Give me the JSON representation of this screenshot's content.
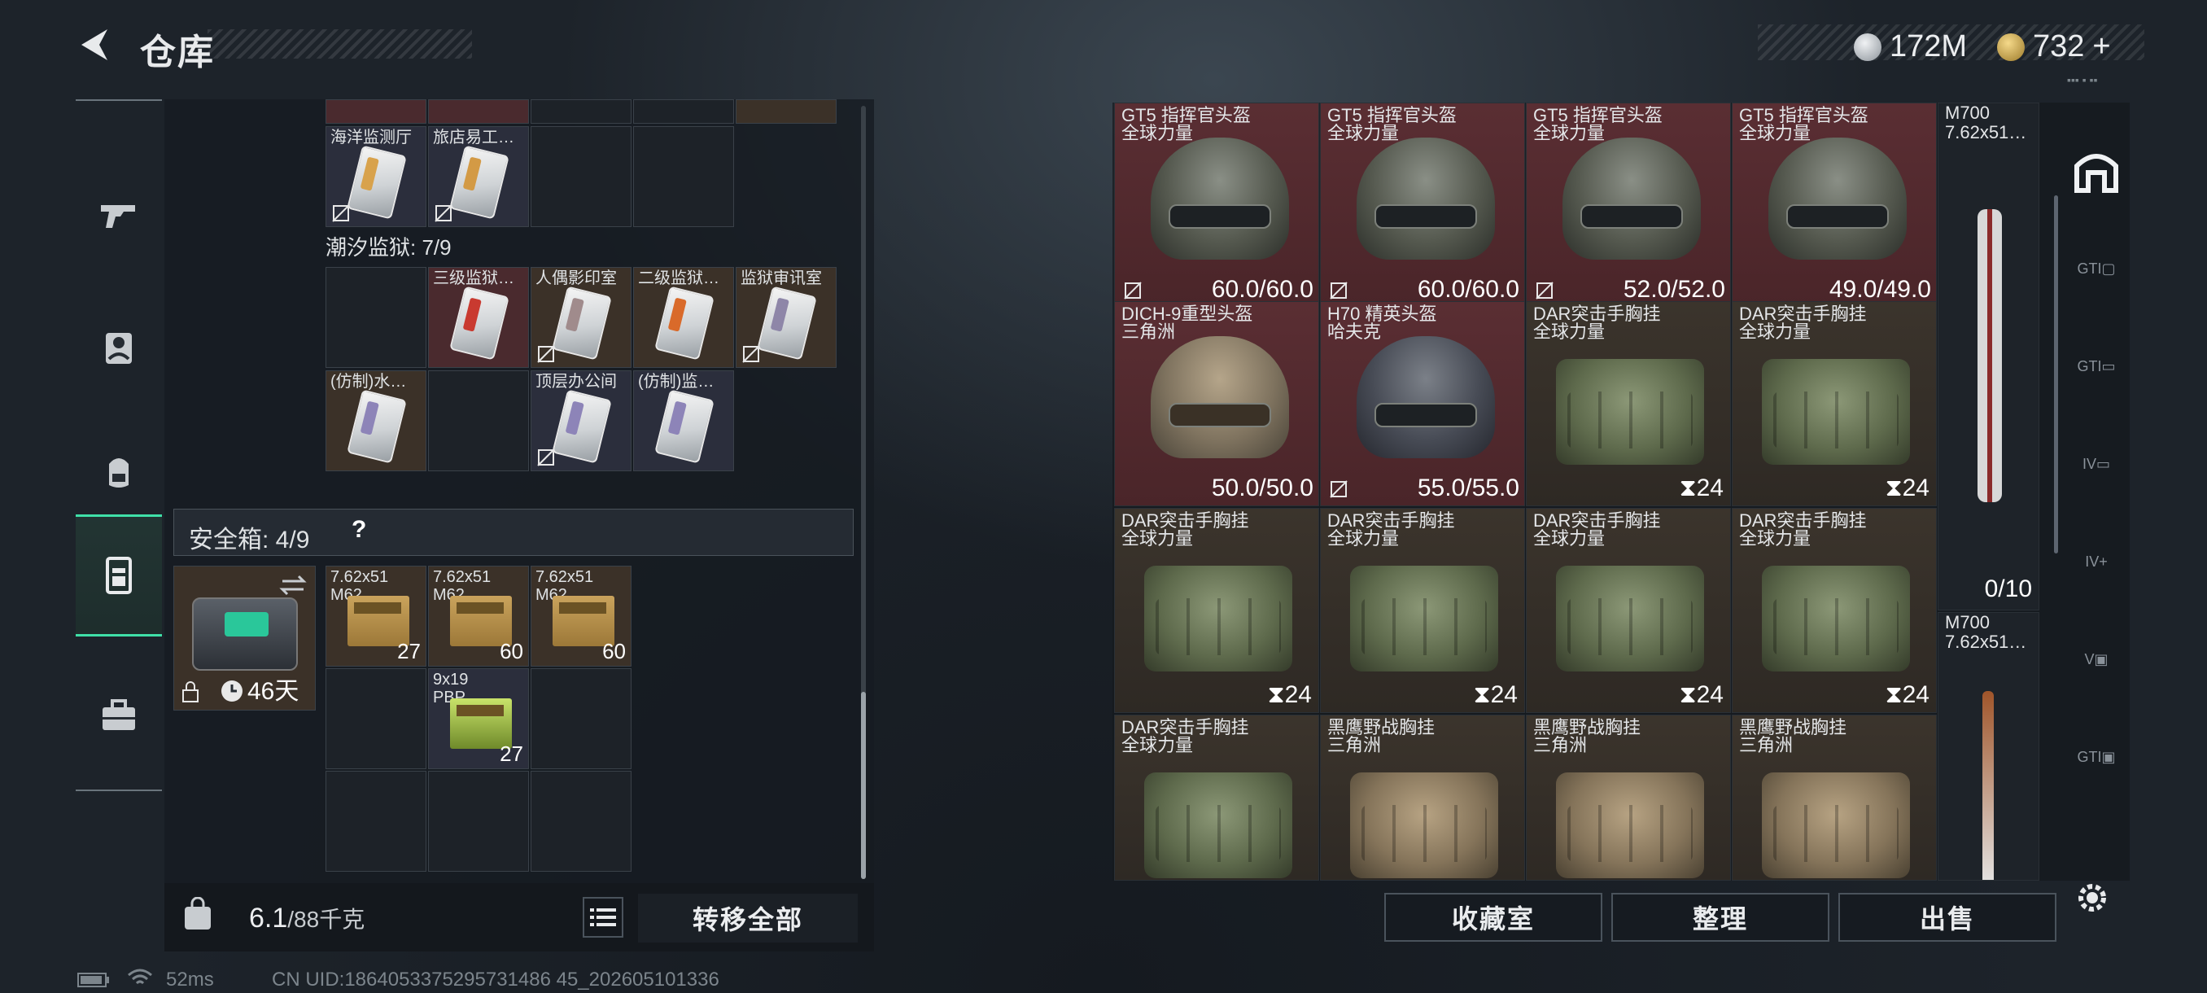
{
  "header": {
    "title": "仓库",
    "currency": [
      {
        "icon": "silver-coin-icon",
        "value": "172M"
      },
      {
        "icon": "gold-coin-icon",
        "value": "732"
      }
    ],
    "plus": "+"
  },
  "sidebar": {
    "items": [
      "gun-icon",
      "character-icon",
      "backpack-icon",
      "chest-rig-icon",
      "briefcase-icon"
    ],
    "active_index": 3
  },
  "left": {
    "top_partial_row": [
      "",
      "",
      "",
      "",
      ""
    ],
    "row1": [
      {
        "label": "海洋监测厅",
        "strip": "#d8a24c"
      },
      {
        "label": "旅店易工…",
        "strip": "#d39a45"
      }
    ],
    "prison_title": "潮汐监狱: 7/9",
    "prison_row1": [
      {
        "label": "",
        "strip": ""
      },
      {
        "label": "三级监狱…",
        "strip": "#c93a30"
      },
      {
        "label": "人偶影印室",
        "strip": "#a08b8c"
      },
      {
        "label": "二级监狱…",
        "strip": "#d96a2a"
      },
      {
        "label": "监狱审讯室",
        "strip": "#8e86a8"
      }
    ],
    "prison_row2": [
      {
        "label": "(仿制)水…",
        "strip": "#8d84b8"
      },
      {
        "label": "",
        "strip": ""
      },
      {
        "label": "顶层办公间",
        "strip": "#8d84b8"
      },
      {
        "label": "(仿制)监…",
        "strip": "#8d84b8"
      }
    ],
    "safebox_title": "安全箱: 4/9",
    "safebox_help": "?",
    "safebox_days": "46天",
    "safe_items": [
      {
        "label": "7.62x51\nM62",
        "count": "27"
      },
      {
        "label": "7.62x51\nM62",
        "count": "60"
      },
      {
        "label": "7.62x51\nM62",
        "count": "60"
      },
      {
        "label": "9x19\nPBP",
        "count": "27"
      }
    ],
    "weight": "6.1",
    "weight_max": "/88千克",
    "transfer_all": "转移全部"
  },
  "right": {
    "grid": [
      [
        {
          "name": "GT5 指挥官头盔",
          "sub": "全球力量",
          "value": "60.0/60.0",
          "type": "helmet",
          "tone": "red"
        },
        {
          "name": "GT5 指挥官头盔",
          "sub": "全球力量",
          "value": "60.0/60.0",
          "type": "helmet",
          "tone": "red"
        },
        {
          "name": "GT5 指挥官头盔",
          "sub": "全球力量",
          "value": "52.0/52.0",
          "type": "helmet",
          "tone": "red"
        },
        {
          "name": "GT5 指挥官头盔",
          "sub": "全球力量",
          "value": "49.0/49.0",
          "type": "helmet",
          "tone": "red"
        }
      ],
      [
        {
          "name": "DICH-9重型头盔",
          "sub": "三角洲",
          "value": "50.0/50.0",
          "type": "helmet-tan",
          "tone": "red"
        },
        {
          "name": "H70 精英头盔",
          "sub": "哈夫克",
          "value": "55.0/55.0",
          "type": "helmet-navy",
          "tone": "red"
        },
        {
          "name": "DAR突击手胸挂",
          "sub": "全球力量",
          "value": "24",
          "type": "bag",
          "tone": "brown"
        },
        {
          "name": "DAR突击手胸挂",
          "sub": "全球力量",
          "value": "24",
          "type": "bag",
          "tone": "brown"
        }
      ],
      [
        {
          "name": "DAR突击手胸挂",
          "sub": "全球力量",
          "value": "24",
          "type": "bag",
          "tone": "brown"
        },
        {
          "name": "DAR突击手胸挂",
          "sub": "全球力量",
          "value": "24",
          "type": "bag",
          "tone": "brown"
        },
        {
          "name": "DAR突击手胸挂",
          "sub": "全球力量",
          "value": "24",
          "type": "bag",
          "tone": "brown"
        },
        {
          "name": "DAR突击手胸挂",
          "sub": "全球力量",
          "value": "24",
          "type": "bag",
          "tone": "brown"
        }
      ],
      [
        {
          "name": "DAR突击手胸挂",
          "sub": "全球力量",
          "value": "",
          "type": "bag",
          "tone": "brown"
        },
        {
          "name": "黑鹰野战胸挂",
          "sub": "三角洲",
          "value": "",
          "type": "bag-khaki",
          "tone": "brown"
        },
        {
          "name": "黑鹰野战胸挂",
          "sub": "三角洲",
          "value": "",
          "type": "bag-khaki",
          "tone": "brown"
        },
        {
          "name": "黑鹰野战胸挂",
          "sub": "三角洲",
          "value": "",
          "type": "bag-khaki",
          "tone": "brown"
        }
      ]
    ],
    "col5": [
      {
        "label": "M700\n7.62x51…",
        "count": "0/10"
      },
      {
        "label": "M700\n7.62x51…",
        "count": ""
      }
    ],
    "tabs": [
      "home-icon",
      "gti-armor-icon",
      "gti-rig-icon",
      "iv-rig-icon",
      "iv-plus-icon",
      "v-icon",
      "gti-box-icon"
    ],
    "buttons": [
      "收藏室",
      "整理",
      "出售"
    ]
  },
  "status": {
    "ping": "52ms",
    "uid": "CN UID:1864053375295731486 45_202605101336"
  }
}
